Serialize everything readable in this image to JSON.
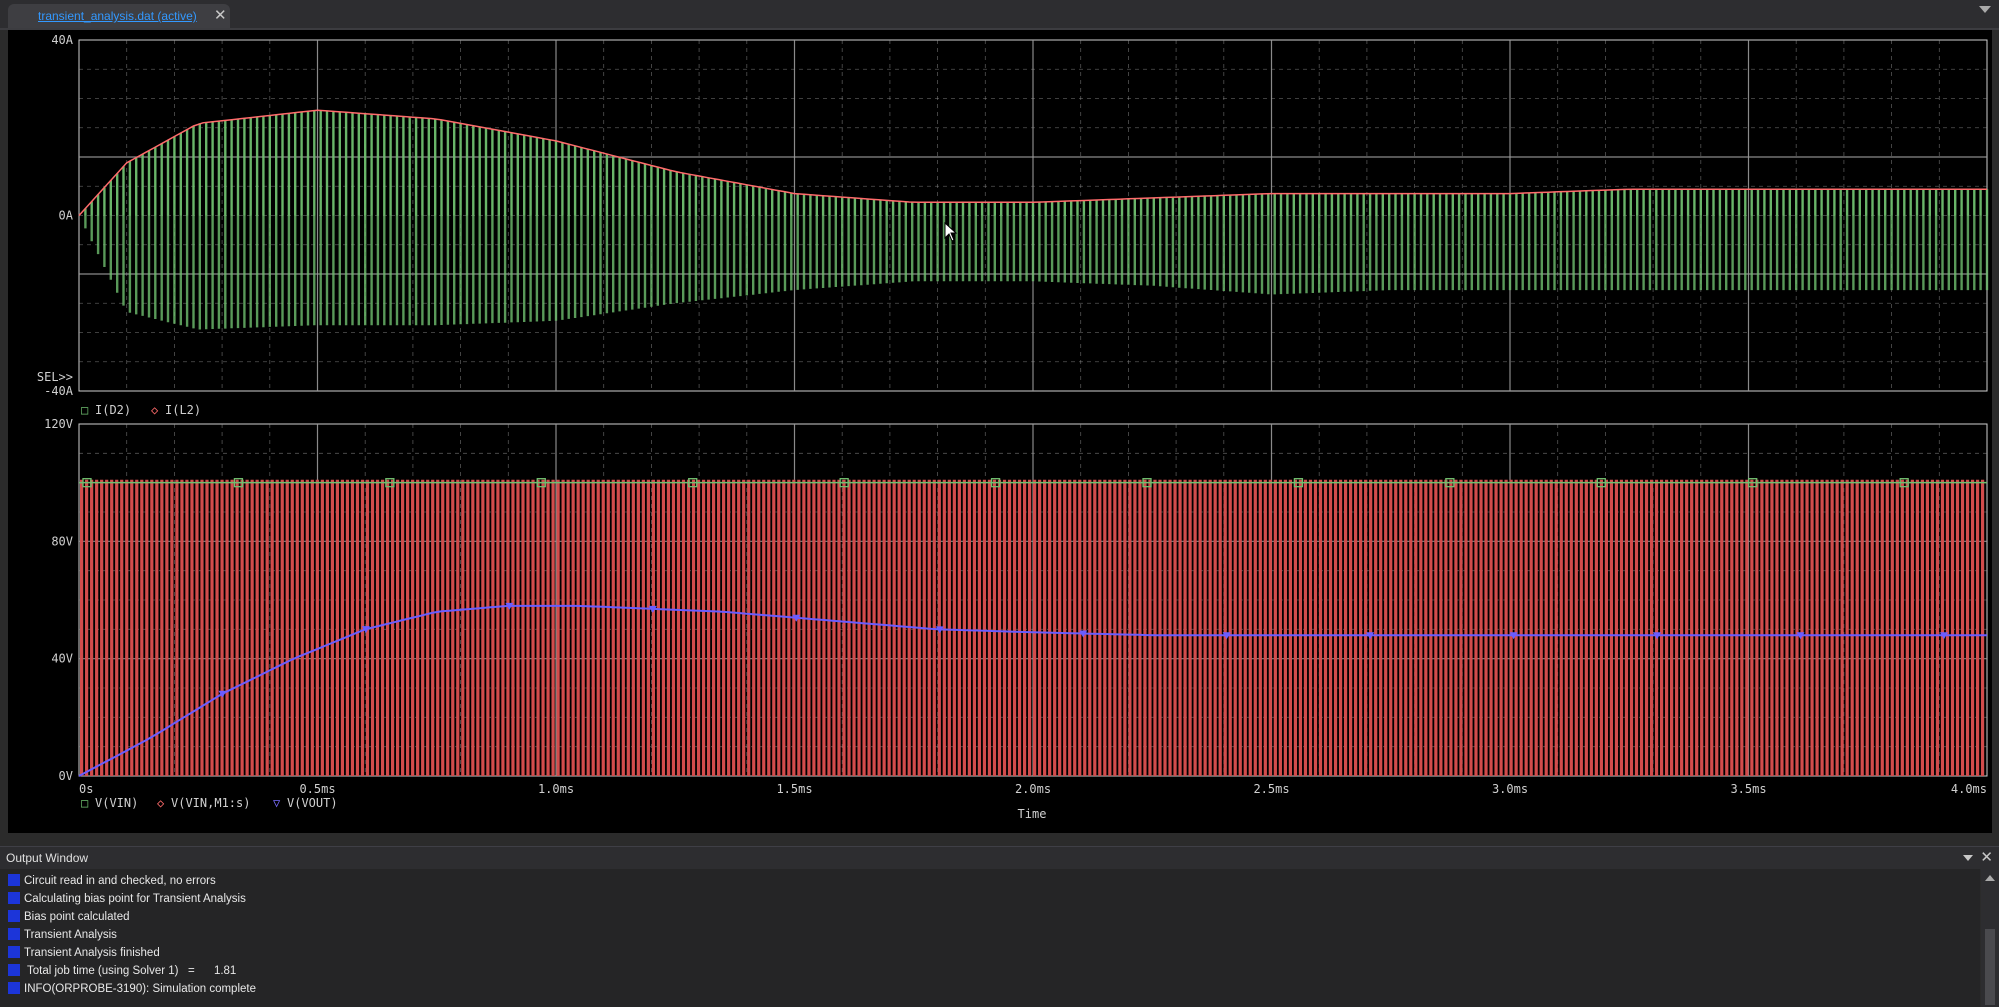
{
  "tab": {
    "label": "transient_analysis.dat (active)",
    "close": "✕"
  },
  "chart_data": [
    {
      "type": "line",
      "panel": "upper",
      "y_ticks": [
        "40A",
        "0A",
        "-40A"
      ],
      "ylim": [
        -40,
        40
      ],
      "sel_marker": "SEL>>",
      "legend": [
        {
          "marker": "□",
          "name": "I(D2)",
          "color": "#6fbf6f"
        },
        {
          "marker": "◇",
          "name": "I(L2)",
          "color": "#ff6b6b"
        }
      ],
      "series": [
        {
          "name": "I(D2)",
          "x_ms": [
            0,
            0.1,
            0.25,
            0.5,
            0.75,
            1.0,
            1.25,
            1.5,
            1.75,
            2.0,
            2.25,
            2.5,
            2.75,
            3.0,
            3.25,
            3.5,
            3.75,
            4.0
          ],
          "envelope_top_A": [
            0,
            12,
            21,
            24,
            22,
            17,
            10,
            5,
            3,
            3,
            4,
            5,
            5,
            5,
            6,
            6,
            6,
            6
          ],
          "envelope_bottom_A": [
            0,
            -22,
            -26,
            -25,
            -25,
            -24,
            -20,
            -17,
            -15,
            -15,
            -16,
            -18,
            -17,
            -17,
            -17,
            -17,
            -17,
            -17
          ]
        },
        {
          "name": "I(L2)",
          "x_ms": [
            0,
            0.1,
            0.25,
            0.5,
            0.75,
            1.0,
            1.25,
            1.5,
            1.75,
            2.0,
            2.25,
            2.5,
            2.75,
            3.0,
            3.25,
            3.5,
            3.75,
            4.0
          ],
          "values_A": [
            0,
            12,
            21,
            24,
            22,
            17,
            10,
            5,
            3,
            3,
            4,
            5,
            5,
            5,
            6,
            6,
            6,
            6
          ]
        }
      ]
    },
    {
      "type": "line",
      "panel": "lower",
      "y_ticks": [
        "120V",
        "80V",
        "40V",
        "0V"
      ],
      "ylim": [
        0,
        120
      ],
      "x_ticks": [
        "0s",
        "0.5ms",
        "1.0ms",
        "1.5ms",
        "2.0ms",
        "2.5ms",
        "3.0ms",
        "3.5ms",
        "4.0ms"
      ],
      "xlim_ms": [
        0,
        4.0
      ],
      "xlabel": "Time",
      "legend": [
        {
          "marker": "□",
          "name": "V(VIN)",
          "color": "#6fbf6f"
        },
        {
          "marker": "◇",
          "name": "V(VIN,M1:s)",
          "color": "#ff6b6b"
        },
        {
          "marker": "▽",
          "name": "V(VOUT)",
          "color": "#7a6dff"
        }
      ],
      "series": [
        {
          "name": "V(VIN)",
          "x_ms": [
            0,
            4.0
          ],
          "values_V": [
            100,
            100
          ]
        },
        {
          "name": "V(VIN,M1:s)",
          "x_ms": [
            0,
            4.0
          ],
          "range_V": [
            0,
            101
          ]
        },
        {
          "name": "V(VOUT)",
          "x_ms": [
            0,
            0.15,
            0.3,
            0.45,
            0.6,
            0.75,
            0.9,
            1.05,
            1.2,
            1.35,
            1.5,
            1.65,
            1.8,
            2.0,
            2.25,
            2.5,
            2.75,
            3.0,
            3.25,
            3.5,
            3.75,
            4.0
          ],
          "values_V": [
            0,
            13,
            28,
            40,
            50,
            56,
            58,
            58,
            57,
            56,
            54,
            52,
            50,
            49,
            48,
            48,
            48,
            48,
            48,
            48,
            48,
            48
          ]
        }
      ]
    }
  ],
  "output": {
    "title": "Output Window",
    "lines": [
      "Circuit read in and checked, no errors",
      "Calculating bias point for Transient Analysis",
      "Bias point calculated",
      "Transient Analysis",
      "Transient Analysis finished",
      " Total job time (using Solver 1)   =      1.81",
      "INFO(ORPROBE-3190): Simulation complete"
    ]
  },
  "colors": {
    "plot_bg": "#000000",
    "grid": "#9a9a9a",
    "green": "#6fbf6f",
    "red": "#d24c4c",
    "blue": "#6a5cff",
    "text": "#d0d0d0",
    "accent_tab": "#3399ff"
  }
}
